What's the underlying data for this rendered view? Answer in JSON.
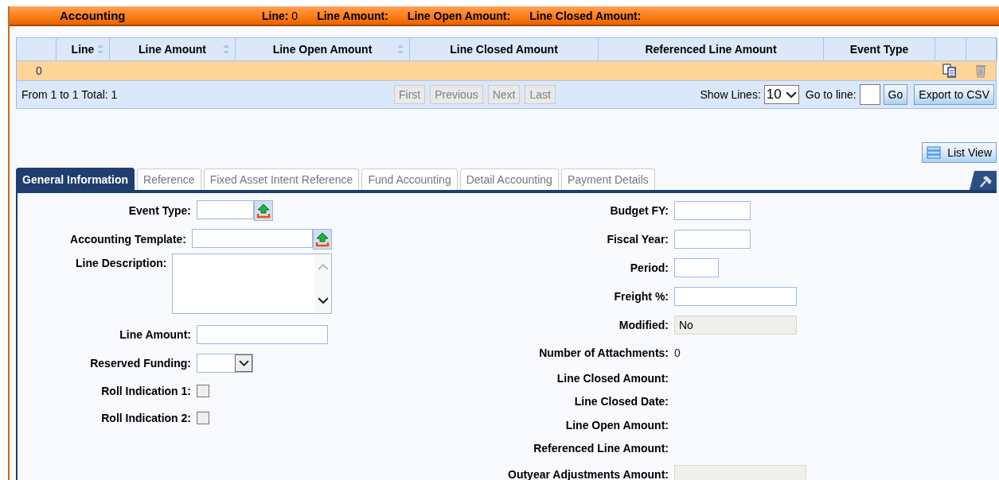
{
  "header": {
    "title": "Accounting",
    "fields": [
      {
        "label": "Line:",
        "value": "0"
      },
      {
        "label": "Line Amount:"
      },
      {
        "label": "Line Open Amount:"
      },
      {
        "label": "Line Closed Amount:"
      }
    ]
  },
  "table": {
    "columns": [
      {
        "sortable": false
      },
      {
        "label": "Line",
        "sortable": true
      },
      {
        "label": "Line Amount",
        "sortable": true
      },
      {
        "label": "Line Open Amount",
        "sortable": true
      },
      {
        "label": "Line Closed Amount",
        "sortable": false
      },
      {
        "label": "Referenced Line Amount",
        "sortable": false
      },
      {
        "label": "Event Type",
        "sortable": false
      },
      {
        "sortable": false
      },
      {
        "sortable": false
      }
    ],
    "rows": [
      {
        "selected": true,
        "cells": [
          "0",
          "",
          "",
          "",
          "",
          ""
        ]
      }
    ]
  },
  "pager": {
    "summary": "From 1 to 1 Total: 1",
    "buttons": [
      {
        "label": "First",
        "disabled": true
      },
      {
        "label": "Previous",
        "disabled": true
      },
      {
        "label": "Next",
        "disabled": true
      },
      {
        "label": "Last",
        "disabled": true
      }
    ],
    "show_lines_label": "Show Lines:",
    "show_lines_value": "10",
    "go_to_line_label": "Go to line:",
    "go_label": "Go",
    "export_label": "Export to CSV"
  },
  "list_view_label": "List View",
  "tabs": [
    {
      "label": "General Information",
      "selected": true
    },
    {
      "label": "Reference",
      "selected": false
    },
    {
      "label": "Fixed Asset Intent Reference",
      "selected": false
    },
    {
      "label": "Fund Accounting",
      "selected": false
    },
    {
      "label": "Detail Accounting",
      "selected": false
    },
    {
      "label": "Payment Details",
      "selected": false
    }
  ],
  "left_fields": [
    {
      "label": "Event Type:",
      "kind": "lookup"
    },
    {
      "label": "Accounting Template:",
      "kind": "lookup"
    },
    {
      "label": "Line Description:",
      "kind": "textarea"
    },
    {
      "label": "Line Amount:",
      "kind": "text"
    },
    {
      "label": "Reserved Funding:",
      "kind": "select"
    },
    {
      "label": "Roll Indication 1:",
      "kind": "checkbox",
      "checked": false
    },
    {
      "label": "Roll Indication 2:",
      "kind": "checkbox",
      "checked": false
    }
  ],
  "right_fields": [
    {
      "label": "Budget FY:",
      "kind": "text"
    },
    {
      "label": "Fiscal Year:",
      "kind": "text"
    },
    {
      "label": "Period:",
      "kind": "text"
    },
    {
      "label": "Freight %:",
      "kind": "text"
    },
    {
      "label": "Modified:",
      "kind": "readonly",
      "value": "No"
    },
    {
      "label": "Number of Attachments:",
      "kind": "value",
      "value": "0"
    },
    {
      "label": "Line Closed Amount:",
      "kind": "value"
    },
    {
      "label": "Line Closed Date:",
      "kind": "value"
    },
    {
      "label": "Line Open Amount:",
      "kind": "value"
    },
    {
      "label": "Referenced Line Amount:",
      "kind": "value"
    },
    {
      "label": "Outyear Adjustments Amount:",
      "kind": "readonly"
    }
  ]
}
